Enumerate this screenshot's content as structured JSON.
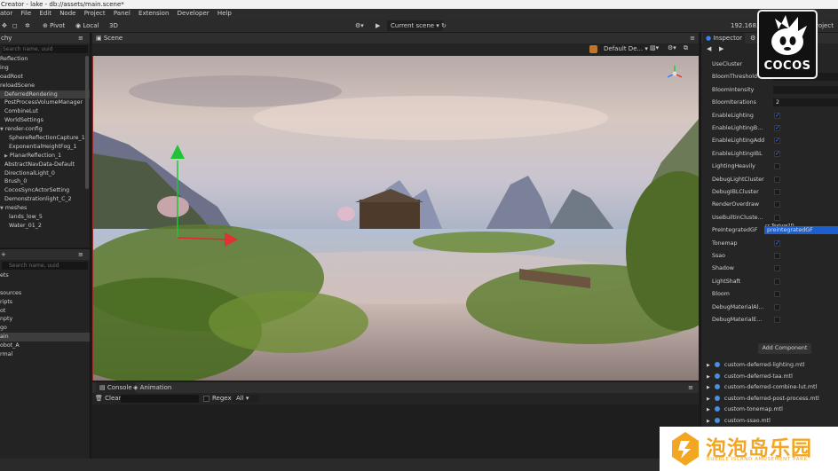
{
  "title": "Creator - lake - db://assets/main.scene*",
  "menu": [
    "ator",
    "File",
    "Edit",
    "Node",
    "Project",
    "Panel",
    "Extension",
    "Developer",
    "Help"
  ],
  "toolbar": {
    "pivot": "Pivot",
    "local": "Local",
    "mode3d": "3D",
    "scene_select": "Current scene",
    "ip": "192.168.",
    "project": "Project"
  },
  "hierarchy": {
    "title": "chy",
    "search_placeholder": "Search name, uuid",
    "items": [
      {
        "label": "Reflection",
        "indent": 0
      },
      {
        "label": "ing",
        "indent": 0
      },
      {
        "label": "oadRoot",
        "indent": 0
      },
      {
        "label": "reloadScene",
        "indent": 0
      },
      {
        "label": "DeferredRendering",
        "indent": 1,
        "sel": true
      },
      {
        "label": "PostProcessVolumeManager",
        "indent": 1
      },
      {
        "label": "CombineLut",
        "indent": 1
      },
      {
        "label": "WorldSettings",
        "indent": 1
      },
      {
        "label": "render-config",
        "indent": 0,
        "tri": true
      },
      {
        "label": "SphereReflectionCapture_1",
        "indent": 2
      },
      {
        "label": "ExponentialHeightFog_1",
        "indent": 2
      },
      {
        "label": "PlanarReflection_1",
        "indent": 1,
        "tri2": true
      },
      {
        "label": "AbstractNavData-Default",
        "indent": 1
      },
      {
        "label": "DirectionalLight_0",
        "indent": 1
      },
      {
        "label": "Brush_0",
        "indent": 1
      },
      {
        "label": "CocosSyncActorSetting",
        "indent": 1
      },
      {
        "label": "Demonstrationlight_C_2",
        "indent": 1
      },
      {
        "label": "meshes",
        "indent": 0,
        "tri": true
      },
      {
        "label": "lands_low_5",
        "indent": 2
      },
      {
        "label": "Water_01_2",
        "indent": 2
      }
    ]
  },
  "assets": {
    "search_placeholder": "Search name, uuid",
    "items": [
      {
        "label": "ets"
      },
      {
        "label": ""
      },
      {
        "label": "sources"
      },
      {
        "label": "ripts"
      },
      {
        "label": "ot"
      },
      {
        "label": "npty"
      },
      {
        "label": "go"
      },
      {
        "label": "ain",
        "sel": true
      },
      {
        "label": "obot_A"
      },
      {
        "label": "rmal"
      }
    ]
  },
  "scene": {
    "tab": "Scene",
    "camera_select": "Default De..."
  },
  "console": {
    "tab_console": "Console",
    "tab_animation": "Animation",
    "clear": "Clear",
    "regex": "Regex",
    "level": "All"
  },
  "inspector": {
    "tab": "Inspector",
    "tab2": "S",
    "logo": "COCOS",
    "props": [
      {
        "label": "UseCluster",
        "type": "none"
      },
      {
        "label": "BloomThreshold",
        "type": "field",
        "value": ""
      },
      {
        "label": "BloomIntensity",
        "type": "field",
        "value": ""
      },
      {
        "label": "BloomIterations",
        "type": "field",
        "value": "2"
      },
      {
        "label": "EnableLighting",
        "type": "check",
        "on": true
      },
      {
        "label": "EnableLightingB...",
        "type": "check",
        "on": true
      },
      {
        "label": "EnableLightingAdd",
        "type": "check",
        "on": true
      },
      {
        "label": "EnableLightingIBL",
        "type": "check",
        "on": true
      },
      {
        "label": "LightingHeavily",
        "type": "check",
        "on": false
      },
      {
        "label": "DebugLightCluster",
        "type": "check",
        "on": false
      },
      {
        "label": "DebugIBLCluster",
        "type": "check",
        "on": false
      },
      {
        "label": "RenderOverdraw",
        "type": "check",
        "on": false
      },
      {
        "label": "UseBuiltinCluste...",
        "type": "check",
        "on": false
      },
      {
        "label": "PreIntegratedGF",
        "type": "asset",
        "value": "preintegratedGF",
        "tag": "cc.Texture2D"
      },
      {
        "label": "Tonemap",
        "type": "check",
        "on": true
      },
      {
        "label": "Ssao",
        "type": "check",
        "on": false
      },
      {
        "label": "Shadow",
        "type": "check",
        "on": false
      },
      {
        "label": "LightShaft",
        "type": "check",
        "on": false
      },
      {
        "label": "Bloom",
        "type": "check",
        "on": false
      },
      {
        "label": "DebugMaterialAl...",
        "type": "check",
        "on": false
      },
      {
        "label": "DebugMaterialE...",
        "type": "check",
        "on": false
      }
    ],
    "add_component": "Add Component",
    "materials": [
      "custom-deferred-lighting.mtl",
      "custom-deferred-taa.mtl",
      "custom-deferred-combine-lut.mtl",
      "custom-deferred-post-process.mtl",
      "custom-tonemap.mtl",
      "custom-ssao.mtl"
    ]
  },
  "watermark": {
    "cn": "泡泡岛乐园",
    "en": "BUBBLE ISLAND AMUSEMENT PARK"
  },
  "colors": {
    "accent": "#3a7fff",
    "watermark_orange": "#f3a621"
  }
}
